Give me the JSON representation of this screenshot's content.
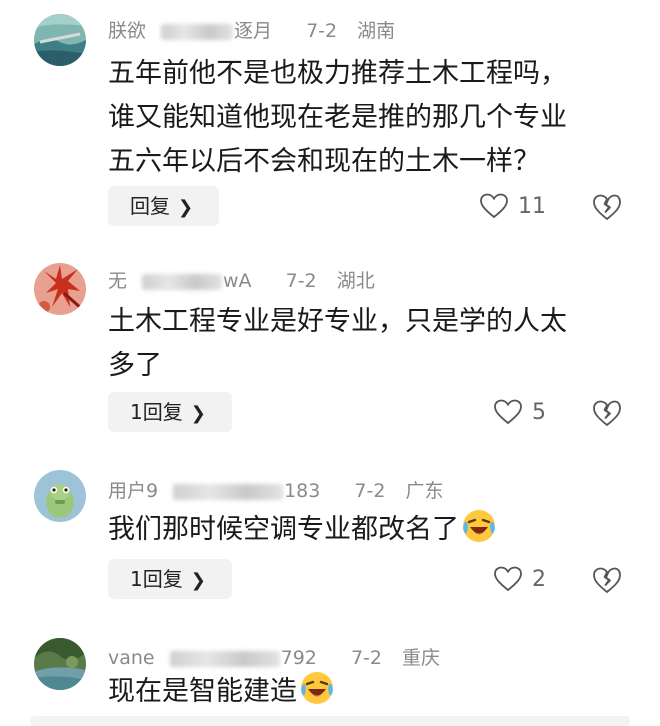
{
  "comments": [
    {
      "username_start": "朕欲",
      "username_end": "逐月",
      "date": "7-2",
      "location": "湖南",
      "lines": [
        "五年前他不是也极力推荐土木工程吗，",
        "谁又能知道他现在老是推的那几个专业",
        "五六年以后不会和现在的土木一样？"
      ],
      "reply_label": "回复",
      "likes": "11"
    },
    {
      "username_start": "无",
      "username_end": "wA",
      "date": "7-2",
      "location": "湖北",
      "lines": [
        "土木工程专业是好专业，只是学的人太",
        "多了"
      ],
      "reply_label": "1回复",
      "likes": "5"
    },
    {
      "username_start": "用户9",
      "username_end": "183",
      "date": "7-2",
      "location": "广东",
      "lines": [
        "我们那时候空调专业都改名了"
      ],
      "reply_label": "1回复",
      "likes": "2"
    },
    {
      "username_start": "vane",
      "username_end": "792",
      "date": "7-2",
      "location": "重庆",
      "lines": [
        "现在是智能建造"
      ]
    }
  ],
  "icons": {
    "chevron": "chevron-right-icon",
    "like": "heart-outline-icon",
    "dislike": "broken-heart-icon",
    "emoji": "laughing-crying-emoji"
  },
  "colors": {
    "meta_gray": "#8a8a8a",
    "button_bg": "#f2f2f2"
  }
}
